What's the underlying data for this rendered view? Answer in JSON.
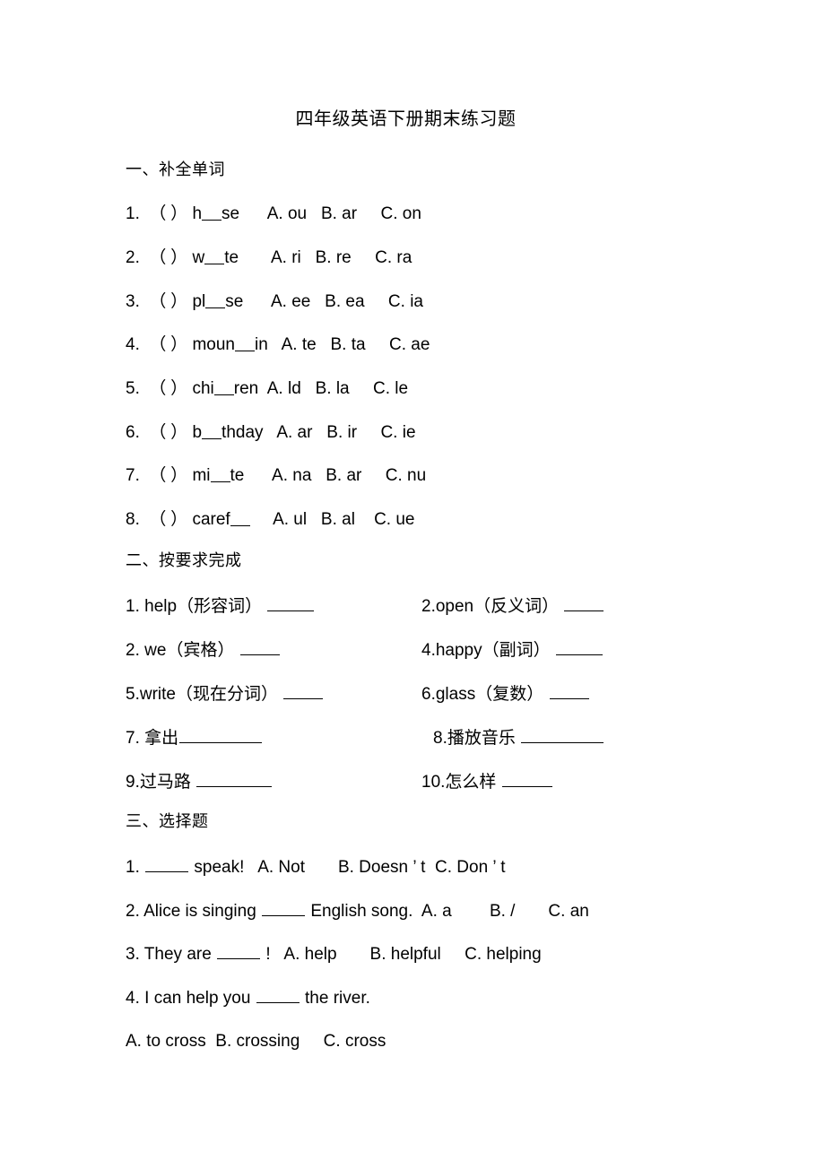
{
  "document": {
    "title": "四年级英语下册期末练习题"
  },
  "section_one": {
    "heading": "一、补全单词",
    "items": [
      {
        "number": "1.",
        "bracket": "（ ）",
        "word_prefix": "h",
        "word_suffix": "se",
        "options": "A. ou   B. ar     C. on"
      },
      {
        "number": "2.",
        "bracket": "（ ）",
        "word_prefix": "w",
        "word_suffix": "te",
        "options": "A. ri   B. re     C. ra"
      },
      {
        "number": "3.",
        "bracket": "（ ）",
        "word_prefix": "pl",
        "word_suffix": "se",
        "options": "A. ee   B. ea     C. ia"
      },
      {
        "number": "4.",
        "bracket": "（ ）",
        "word_prefix": "moun",
        "word_suffix": "in",
        "options": "A. te   B. ta     C. ae"
      },
      {
        "number": "5.",
        "bracket": "（ ）",
        "word_prefix": "chi",
        "word_suffix": "ren",
        "options": "A. ld   B. la     C. le"
      },
      {
        "number": "6.",
        "bracket": "（ ）",
        "word_prefix": "b",
        "word_suffix": "thday",
        "options": "A. ar   B. ir     C. ie"
      },
      {
        "number": "7.",
        "bracket": "（ ）",
        "word_prefix": "mi",
        "word_suffix": "te",
        "options": "A. na   B. ar     C. nu"
      },
      {
        "number": "8.",
        "bracket": "（ ）",
        "word_prefix": "caref",
        "word_suffix": "",
        "options": "A. ul   B. al    C. ue"
      }
    ]
  },
  "section_two": {
    "heading": "二、按要求完成",
    "rows": [
      {
        "left": {
          "number": "1.",
          "word": "help",
          "note": "（形容词）"
        },
        "right": {
          "number": "2.",
          "word": "open",
          "note": "（反义词）"
        }
      },
      {
        "left": {
          "number": "2.",
          "word": "we",
          "note": "（宾格）"
        },
        "right": {
          "number": "4.",
          "word": "happy",
          "note": "（副词）"
        }
      },
      {
        "left": {
          "number": "5.",
          "word": "write",
          "note": "（现在分词）"
        },
        "right": {
          "number": "6.",
          "word": "glass",
          "note": "（复数）"
        }
      },
      {
        "left": {
          "number": "7.",
          "word": "拿出",
          "note": ""
        },
        "right": {
          "number": "8.",
          "word": "播放音乐",
          "note": ""
        }
      },
      {
        "left": {
          "number": "9.",
          "word": "过马路",
          "note": ""
        },
        "right": {
          "number": "10.",
          "word": "怎么样",
          "note": ""
        }
      }
    ]
  },
  "section_three": {
    "heading": "三、选择题",
    "questions": [
      {
        "number": "1.",
        "stem_before": "",
        "stem_after": " speak!",
        "options": "A. Not       B. Doesn ’ t  C. Don ’ t",
        "options_own_line": ""
      },
      {
        "number": "2.",
        "stem_before": "Alice is singing ",
        "stem_after": " English song.",
        "options": "A. a        B. /       C. an",
        "options_own_line": ""
      },
      {
        "number": "3.",
        "stem_before": "They are ",
        "stem_after": " !",
        "options": "A. help       B. helpful     C. helping",
        "options_own_line": ""
      },
      {
        "number": "4.",
        "stem_before": "I can help you ",
        "stem_after": " the river.",
        "options": "",
        "options_own_line": "A. to cross  B. crossing     C. cross"
      }
    ]
  }
}
